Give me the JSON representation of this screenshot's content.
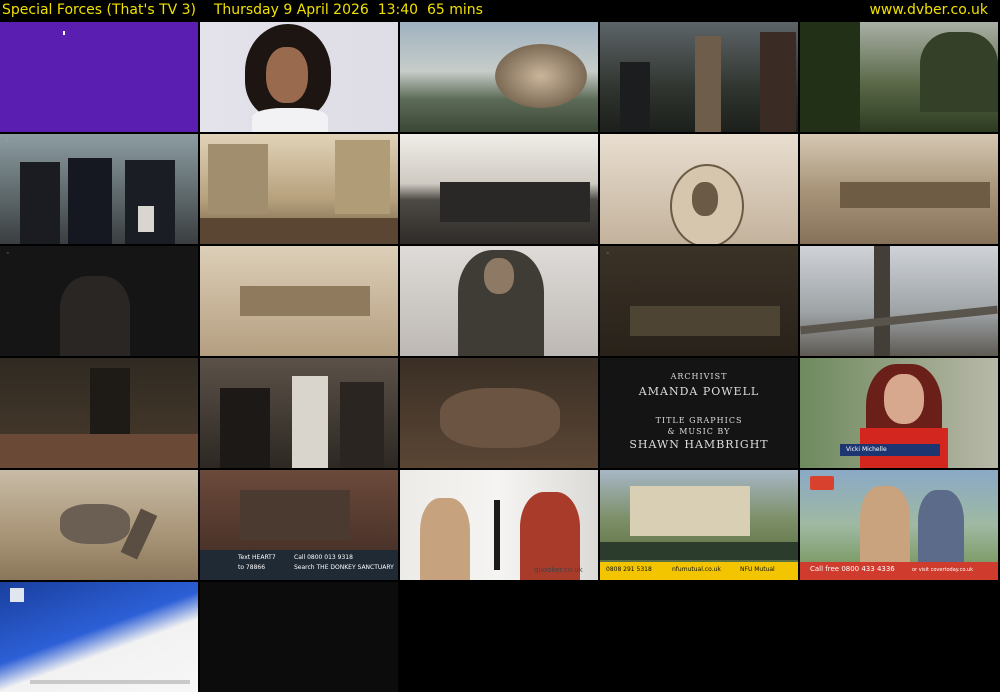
{
  "header": {
    "channel_title": "Special Forces (That's TV 3)",
    "broadcast_info": "Thursday 9 April 2026  13:40  65 mins",
    "site_url": "www.dvber.co.uk"
  },
  "thumbnails": {
    "t19": {
      "caption_role": "ARCHIVIST",
      "caption_name": "AMANDA POWELL",
      "caption_line3": "TITLE GRAPHICS",
      "caption_line4": "& MUSIC BY",
      "caption_line5": "SHAWN HAMBRIGHT"
    },
    "t20": {
      "lower_third_name": "Vicki Michelle"
    },
    "t22": {
      "text_label": "Text HEART7",
      "text_to": "to 78866",
      "call_label": "Call 0800 013 9318",
      "search_label": "Search THE DONKEY SANCTUARY"
    },
    "t23": {
      "brand": "quooker.co.uk"
    },
    "t24": {
      "phone": "0808 291 5318",
      "site": "nfumutual.co.uk",
      "brand": "NFU Mutual"
    },
    "t25": {
      "call_free": "Call free 0800 433 4336",
      "visit": "or visit covertoday.co.uk"
    }
  },
  "colors": {
    "header_text": "#f0e000",
    "background": "#000000",
    "purple_tile": "#5a1fb0"
  }
}
